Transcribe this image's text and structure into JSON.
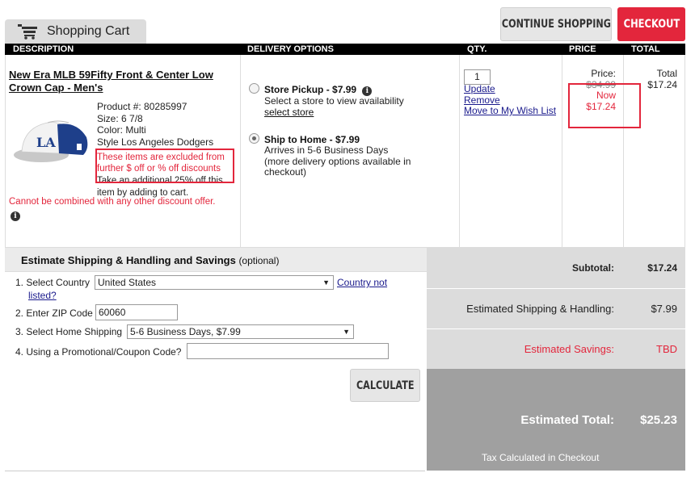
{
  "header": {
    "cart_tab_label": "Shopping Cart",
    "continue_label": "CONTINUE SHOPPING",
    "checkout_label": "CHECKOUT",
    "columns": {
      "description": "DESCRIPTION",
      "delivery": "DELIVERY OPTIONS",
      "qty": "QTY.",
      "price": "PRICE",
      "total": "TOTAL"
    }
  },
  "item": {
    "title": "New Era MLB 59Fifty Front & Center Low Crown Cap - Men's",
    "product_no": "Product #: 80285997",
    "size": "Size: 6 7/8",
    "color": "Color: Multi",
    "style": "Style Los Angeles Dodgers",
    "excluded_note": "These items are excluded from further $ off or % off discounts",
    "additional_note": "Take an additional 25% off this item by adding to cart.",
    "cannot_combine": "Cannot be combined with any other discount offer.",
    "info_glyph": "i"
  },
  "delivery": {
    "store_pickup_title": "Store Pickup - $7.99",
    "store_pickup_text": "Select a store to view availability",
    "select_store_link": "select store",
    "ship_home_title": "Ship to Home - $7.99",
    "ship_home_line1": "Arrives in 5-6 Business Days",
    "ship_home_line2": "(more delivery options available in",
    "ship_home_line3": "checkout)",
    "selected": "ship_to_home"
  },
  "qty": {
    "value": "1",
    "update": "Update",
    "remove": "Remove",
    "wishlist": "Move to My Wish List"
  },
  "price": {
    "label": "Price:",
    "original": "$34.99",
    "now_label": "Now",
    "now": "$17.24",
    "total_label": "Total",
    "total": "$17.24"
  },
  "estimate": {
    "title": "Estimate Shipping & Handling and Savings",
    "optional": "(optional)",
    "row1_label": "1.  Select Country",
    "country": "United States",
    "country_link_1": "Country not",
    "country_link_2": "listed?",
    "row2_label": "2.  Enter ZIP Code",
    "zip": "60060",
    "row3_label": "3.  Select Home Shipping",
    "shipping": "5-6 Business Days, $7.99",
    "row4_label": "4.  Using a Promotional/Coupon Code?",
    "coupon": "",
    "calculate_label": "CALCULATE"
  },
  "summary": {
    "subtotal_label": "Subtotal:",
    "subtotal": "$17.24",
    "shipping_label": "Estimated Shipping & Handling:",
    "shipping": "$7.99",
    "savings_label": "Estimated Savings:",
    "savings": "TBD",
    "total_label": "Estimated Total:",
    "total": "$25.23",
    "tax_note": "Tax Calculated in Checkout"
  },
  "colors": {
    "accent_red": "#e3263c",
    "header_black": "#000000",
    "summary_gray": "#a0a0a0"
  }
}
